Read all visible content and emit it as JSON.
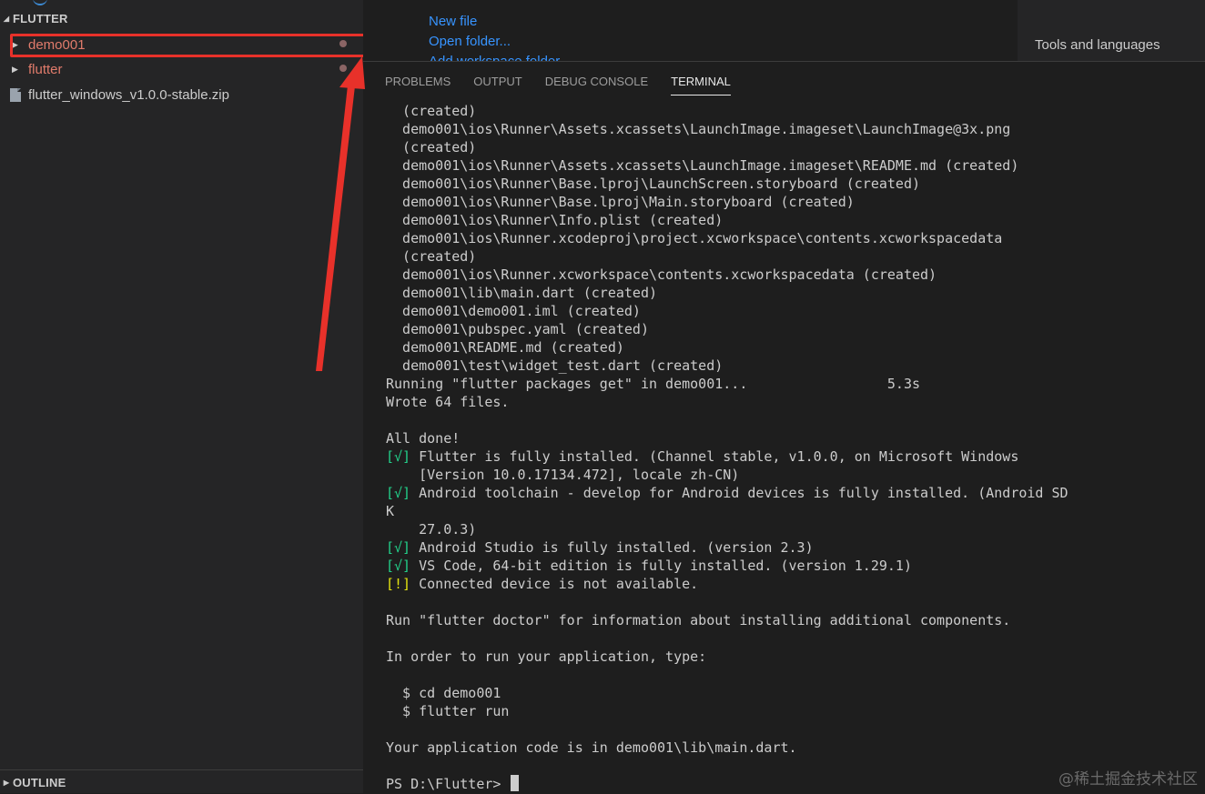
{
  "sidebar": {
    "section_title": "FLUTTER",
    "items": [
      {
        "label": "demo001",
        "color": "#e07b6b",
        "type": "folder"
      },
      {
        "label": "flutter",
        "color": "#e07b6b",
        "type": "folder"
      },
      {
        "label": "flutter_windows_v1.0.0-stable.zip",
        "color": "#cccccc",
        "type": "file"
      }
    ],
    "outline_title": "OUTLINE"
  },
  "welcome": {
    "new_file": "New file",
    "open_folder": "Open folder...",
    "add_workspace_folder": "Add workspace folder...",
    "tools_and_languages": "Tools and languages"
  },
  "panel": {
    "tabs": [
      "PROBLEMS",
      "OUTPUT",
      "DEBUG CONSOLE",
      "TERMINAL"
    ],
    "active_tab": "TERMINAL"
  },
  "terminal": {
    "lines": [
      {
        "segments": [
          {
            "t": "  (created)"
          }
        ]
      },
      {
        "segments": [
          {
            "t": "  demo001\\ios\\Runner\\Assets.xcassets\\LaunchImage.imageset\\LaunchImage@3x.png"
          }
        ]
      },
      {
        "segments": [
          {
            "t": "  (created)"
          }
        ]
      },
      {
        "segments": [
          {
            "t": "  demo001\\ios\\Runner\\Assets.xcassets\\LaunchImage.imageset\\README.md (created)"
          }
        ]
      },
      {
        "segments": [
          {
            "t": "  demo001\\ios\\Runner\\Base.lproj\\LaunchScreen.storyboard (created)"
          }
        ]
      },
      {
        "segments": [
          {
            "t": "  demo001\\ios\\Runner\\Base.lproj\\Main.storyboard (created)"
          }
        ]
      },
      {
        "segments": [
          {
            "t": "  demo001\\ios\\Runner\\Info.plist (created)"
          }
        ]
      },
      {
        "segments": [
          {
            "t": "  demo001\\ios\\Runner.xcodeproj\\project.xcworkspace\\contents.xcworkspacedata"
          }
        ]
      },
      {
        "segments": [
          {
            "t": "  (created)"
          }
        ]
      },
      {
        "segments": [
          {
            "t": "  demo001\\ios\\Runner.xcworkspace\\contents.xcworkspacedata (created)"
          }
        ]
      },
      {
        "segments": [
          {
            "t": "  demo001\\lib\\main.dart (created)"
          }
        ]
      },
      {
        "segments": [
          {
            "t": "  demo001\\demo001.iml (created)"
          }
        ]
      },
      {
        "segments": [
          {
            "t": "  demo001\\pubspec.yaml (created)"
          }
        ]
      },
      {
        "segments": [
          {
            "t": "  demo001\\README.md (created)"
          }
        ]
      },
      {
        "segments": [
          {
            "t": "  demo001\\test\\widget_test.dart (created)"
          }
        ]
      },
      {
        "segments": [
          {
            "t": "Running \"flutter packages get\" in demo001...                 5.3s"
          }
        ]
      },
      {
        "segments": [
          {
            "t": "Wrote 64 files."
          }
        ]
      },
      {
        "segments": [
          {
            "t": ""
          }
        ]
      },
      {
        "segments": [
          {
            "t": "All done!"
          }
        ]
      },
      {
        "segments": [
          {
            "t": "[√]",
            "c": "green"
          },
          {
            "t": " Flutter is fully installed. (Channel stable, v1.0.0, on Microsoft Windows"
          }
        ]
      },
      {
        "segments": [
          {
            "t": "    [Version 10.0.17134.472], locale zh-CN)"
          }
        ]
      },
      {
        "segments": [
          {
            "t": "[√]",
            "c": "green"
          },
          {
            "t": " Android toolchain - develop for Android devices is fully installed. (Android SD"
          }
        ]
      },
      {
        "segments": [
          {
            "t": "K"
          }
        ]
      },
      {
        "segments": [
          {
            "t": "    27.0.3)"
          }
        ]
      },
      {
        "segments": [
          {
            "t": "[√]",
            "c": "green"
          },
          {
            "t": " Android Studio is fully installed. (version 2.3)"
          }
        ]
      },
      {
        "segments": [
          {
            "t": "[√]",
            "c": "green"
          },
          {
            "t": " VS Code, 64-bit edition is fully installed. (version 1.29.1)"
          }
        ]
      },
      {
        "segments": [
          {
            "t": "[!]",
            "c": "yellow"
          },
          {
            "t": " Connected device is not available."
          }
        ]
      },
      {
        "segments": [
          {
            "t": ""
          }
        ]
      },
      {
        "segments": [
          {
            "t": "Run \"flutter doctor\" for information about installing additional components."
          }
        ]
      },
      {
        "segments": [
          {
            "t": ""
          }
        ]
      },
      {
        "segments": [
          {
            "t": "In order to run your application, type:"
          }
        ]
      },
      {
        "segments": [
          {
            "t": ""
          }
        ]
      },
      {
        "segments": [
          {
            "t": "  $ cd demo001"
          }
        ]
      },
      {
        "segments": [
          {
            "t": "  $ flutter run"
          }
        ]
      },
      {
        "segments": [
          {
            "t": ""
          }
        ]
      },
      {
        "segments": [
          {
            "t": "Your application code is in demo001\\lib\\main.dart."
          }
        ]
      },
      {
        "segments": [
          {
            "t": ""
          }
        ]
      }
    ],
    "prompt": "PS D:\\Flutter> "
  },
  "watermark": "@稀土掘金技术社区",
  "colors": {
    "annotation_red": "#e8312a",
    "link_blue": "#3794ff"
  }
}
